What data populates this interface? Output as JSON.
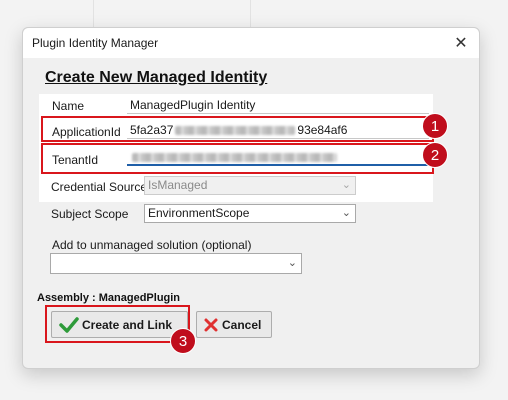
{
  "dialog": {
    "title": "Plugin Identity Manager",
    "close_glyph": "✕",
    "heading": "Create New Managed Identity"
  },
  "fields": {
    "name_label": "Name",
    "name_value": "ManagedPlugin Identity",
    "application_id_label": "ApplicationId",
    "application_id_prefix": "5fa2a37",
    "application_id_suffix": "93e84af6",
    "tenant_id_label": "TenantId",
    "credential_source_label": "Credential Source",
    "credential_source_value": "IsManaged",
    "subject_scope_label": "Subject Scope",
    "subject_scope_value": "EnvironmentScope",
    "solution_label": "Add to unmanaged solution (optional)",
    "solution_value": ""
  },
  "assembly_text": "Assembly : ManagedPlugin",
  "buttons": {
    "create_label": "Create and Link",
    "cancel_label": "Cancel"
  },
  "callouts": [
    "1",
    "2",
    "3"
  ],
  "colors": {
    "callout_red": "#d9161c",
    "badge_fill": "#c00d1c",
    "check_green": "#2e9b3a",
    "cancel_red": "#e03030"
  }
}
